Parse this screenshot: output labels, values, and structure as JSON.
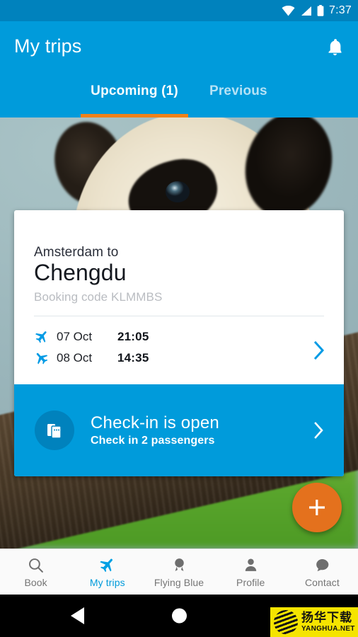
{
  "status_bar": {
    "time": "7:37",
    "icons": [
      "wifi-icon",
      "cellular-signal-icon",
      "battery-icon"
    ]
  },
  "app_bar": {
    "title": "My trips",
    "notification_icon": "bell-icon"
  },
  "tabs": [
    {
      "label": "Upcoming (1)",
      "active": true
    },
    {
      "label": "Previous",
      "active": false
    }
  ],
  "trip_card": {
    "route_from": "Amsterdam to",
    "route_to": "Chengdu",
    "booking_code": "Booking code KLMMBS",
    "legs": [
      {
        "icon": "plane-departure-icon",
        "date": "07 Oct",
        "time": "21:05"
      },
      {
        "icon": "plane-arrival-icon",
        "date": "08 Oct",
        "time": "14:35"
      }
    ],
    "chevron_icon": "chevron-right-icon"
  },
  "check_in_banner": {
    "badge_icon": "boarding-pass-icon",
    "title": "Check-in is open",
    "subtitle": "Check in 2 passengers",
    "chevron_icon": "chevron-right-icon"
  },
  "fab": {
    "icon": "plus-icon",
    "color": "#e4711d"
  },
  "bottom_nav": [
    {
      "label": "Book",
      "icon": "search-icon",
      "active": false
    },
    {
      "label": "My trips",
      "icon": "airplane-icon",
      "active": true
    },
    {
      "label": "Flying Blue",
      "icon": "medal-icon",
      "active": false
    },
    {
      "label": "Profile",
      "icon": "person-icon",
      "active": false
    },
    {
      "label": "Contact",
      "icon": "chat-bubble-icon",
      "active": false
    }
  ],
  "system_bar": {
    "back_icon": "back-triangle-icon",
    "home_icon": "home-circle-icon"
  },
  "watermark": {
    "cn_text": "扬华下载",
    "en_text": "YANGHUA.NET"
  },
  "colors": {
    "status_bar": "#0082bd",
    "app_bar": "#009bdb",
    "accent_orange": "#f08118",
    "fab_orange": "#e4711d",
    "active_nav": "#009bdb",
    "inactive_nav": "#757575"
  }
}
